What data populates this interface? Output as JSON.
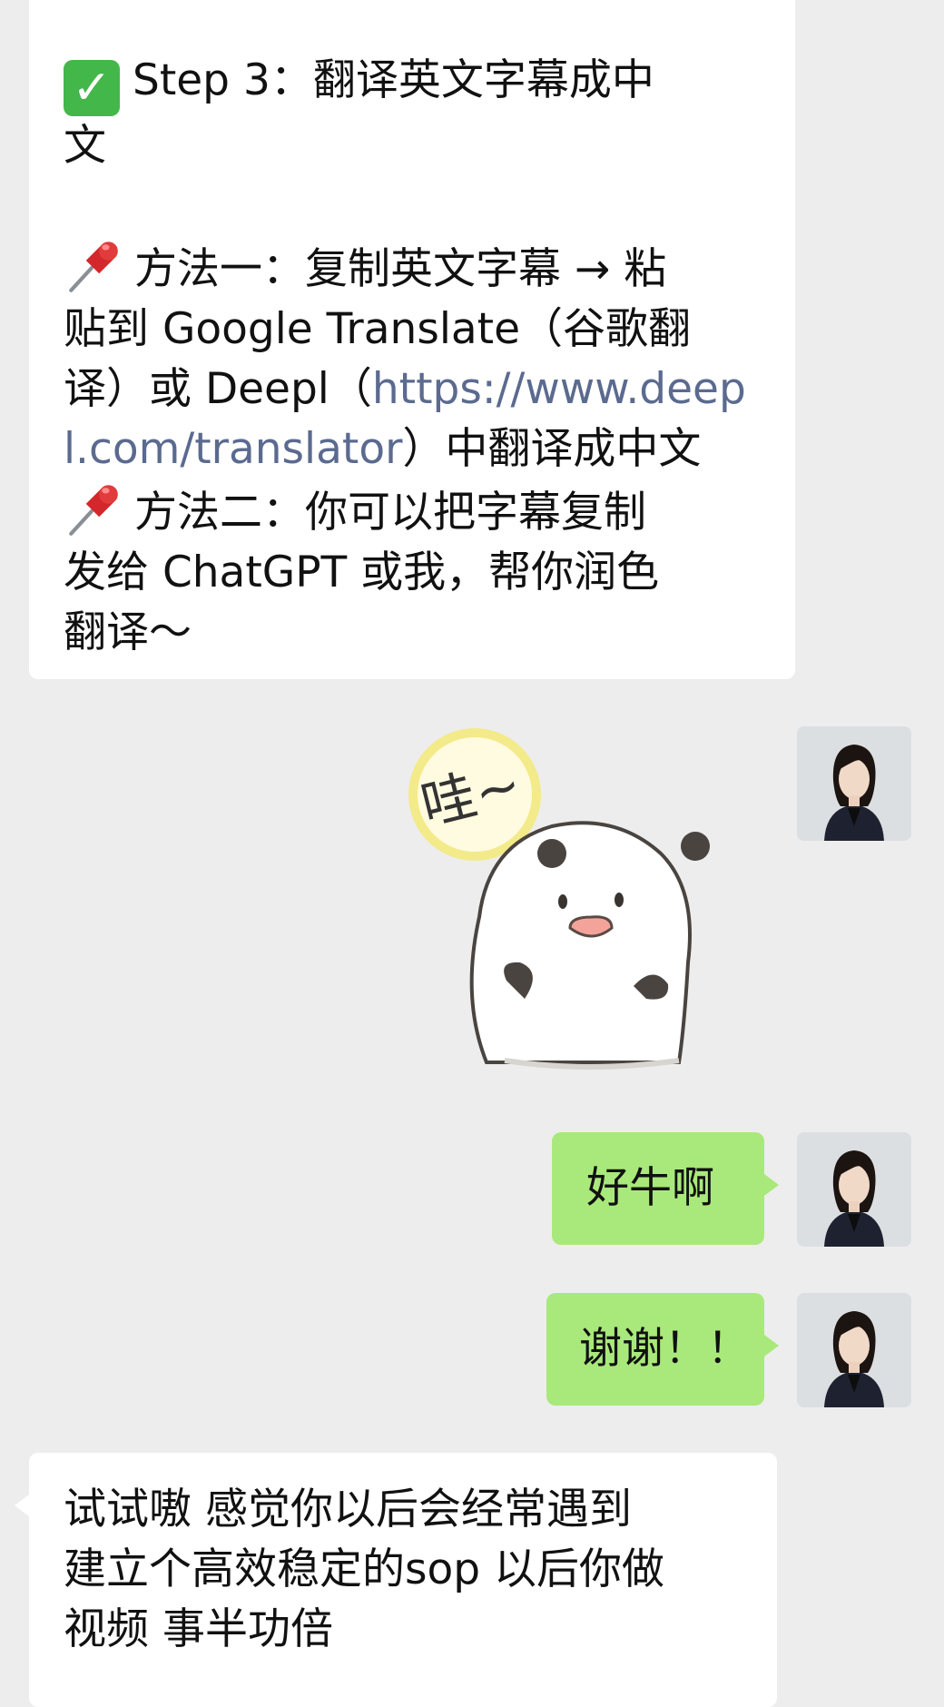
{
  "messages": {
    "m1": {
      "step_line": "Step 3：翻译英文字幕成中",
      "step_line2": "文",
      "method1_l1": "方法一：复制英文字幕 → 粘",
      "method1_l2": "贴到 Google Translate（谷歌翻",
      "method1_l3_a": "译）或 Deepl（",
      "method1_link_a": "https://www.deep",
      "method1_link_b": "l.com/translator",
      "method1_l4_b": "）中翻译成中文",
      "method2_l1": "方法二：你可以把字幕复制",
      "method2_l2": "发给 ChatGPT 或我，帮你润色",
      "method2_l3": "翻译～"
    },
    "m2": {
      "sticker_text": "哇~"
    },
    "m3": {
      "text": "好牛啊"
    },
    "m4": {
      "text": "谢谢！！"
    },
    "m5": {
      "l1": "试试嗷 感觉你以后会经常遇到",
      "l2": "建立个高效稳定的sop 以后你做",
      "l3": "视频 事半功倍"
    }
  },
  "icons": {
    "check": "check-mark-emoji",
    "pin": "pushpin-emoji"
  },
  "colors": {
    "background": "#ededed",
    "incoming_bubble": "#ffffff",
    "outgoing_bubble": "#a9e97b",
    "link": "#5b6a8f"
  }
}
